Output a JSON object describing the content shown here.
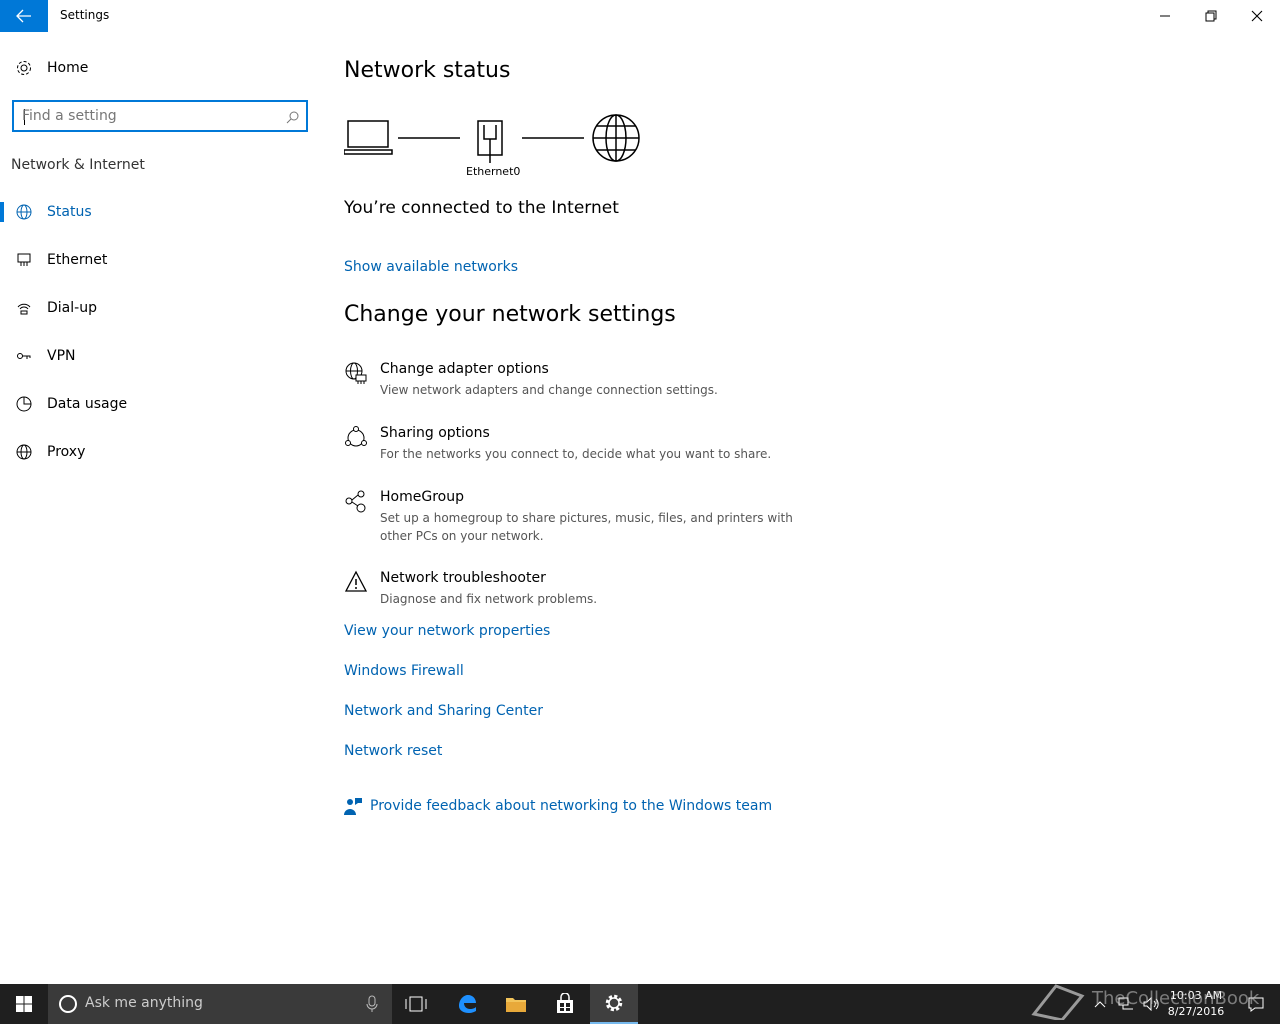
{
  "window": {
    "title": "Settings",
    "back_icon": "arrow-left-icon",
    "controls": [
      "minimize-icon",
      "restore-icon",
      "close-icon"
    ]
  },
  "sidebar": {
    "home_label": "Home",
    "search_placeholder": "Find a setting",
    "section_label": "Network & Internet",
    "items": [
      {
        "label": "Status",
        "icon": "globe-icon",
        "active": true
      },
      {
        "label": "Ethernet",
        "icon": "ethernet-icon",
        "active": false
      },
      {
        "label": "Dial-up",
        "icon": "dialup-icon",
        "active": false
      },
      {
        "label": "VPN",
        "icon": "vpn-icon",
        "active": false
      },
      {
        "label": "Data usage",
        "icon": "pie-chart-icon",
        "active": false
      },
      {
        "label": "Proxy",
        "icon": "globe-icon",
        "active": false
      }
    ]
  },
  "main": {
    "status_heading": "Network status",
    "adapter_label": "Ethernet0",
    "connection_status": "You’re connected to the Internet",
    "show_networks_link": "Show available networks",
    "change_heading": "Change your network settings",
    "options": [
      {
        "title": "Change adapter options",
        "desc": "View network adapters and change connection settings.",
        "icon": "adapter-icon"
      },
      {
        "title": "Sharing options",
        "desc": "For the networks you connect to, decide what you want to share.",
        "icon": "sharing-icon"
      },
      {
        "title": "HomeGroup",
        "desc": "Set up a homegroup to share pictures, music, files, and printers with other PCs on your network.",
        "icon": "homegroup-icon"
      },
      {
        "title": "Network troubleshooter",
        "desc": "Diagnose and fix network problems.",
        "icon": "warning-icon"
      }
    ],
    "links": [
      "View your network properties",
      "Windows Firewall",
      "Network and Sharing Center",
      "Network reset"
    ],
    "feedback_link": "Provide feedback about networking to the Windows team"
  },
  "taskbar": {
    "search_text": "Ask me anything",
    "time": "10:03 AM",
    "date": "8/27/2016",
    "watermark": "TheCollectionBook",
    "accent": "#0078d7"
  }
}
